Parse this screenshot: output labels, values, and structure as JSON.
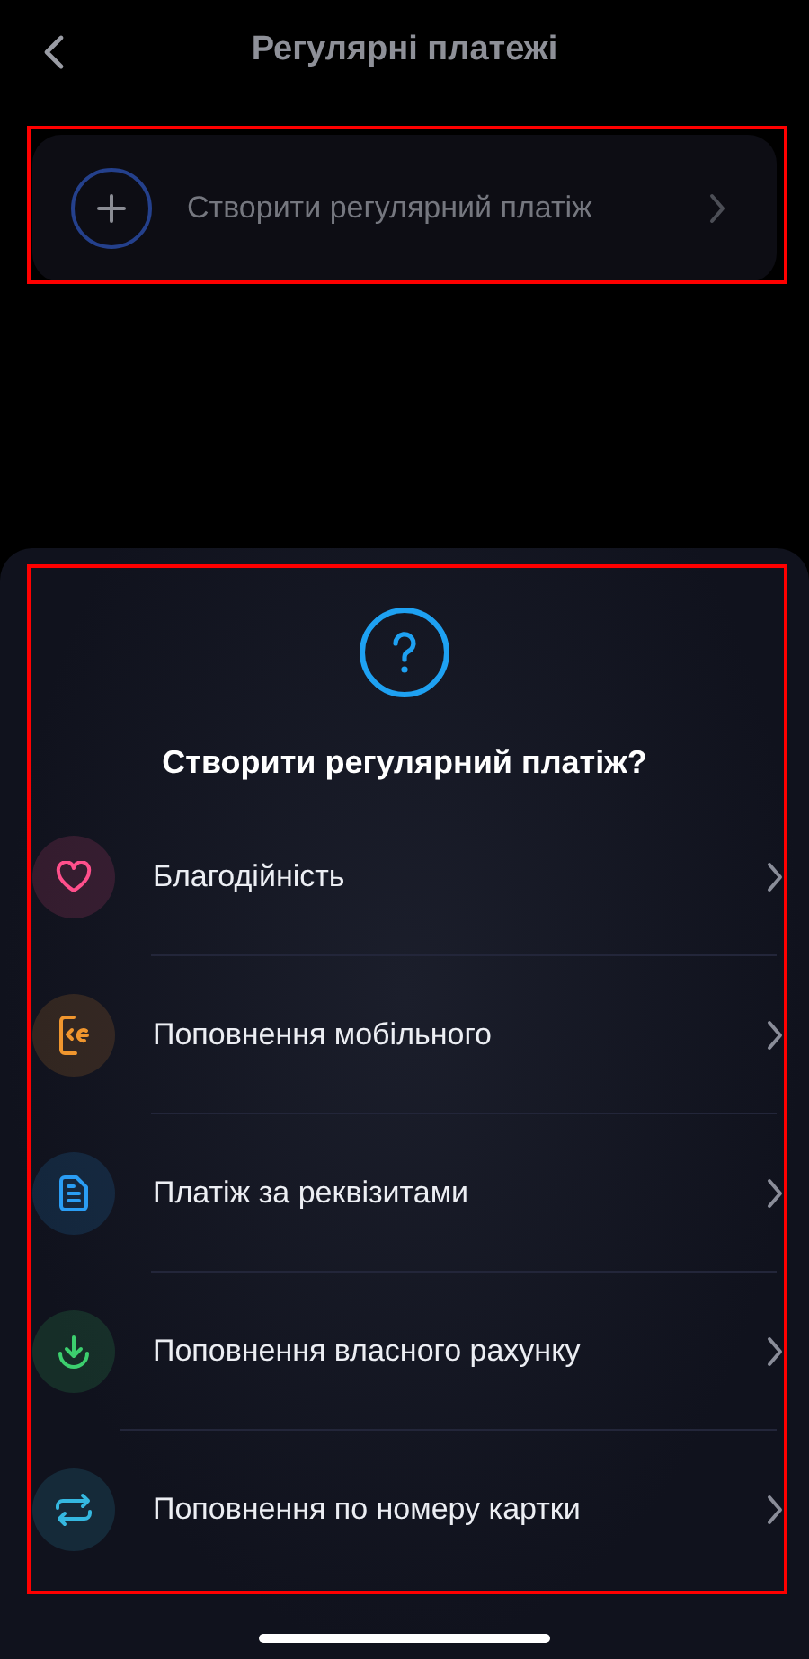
{
  "header": {
    "title": "Регулярні платежі"
  },
  "create_card": {
    "label": "Створити регулярний платіж"
  },
  "sheet": {
    "title": "Створити регулярний платіж?",
    "options": [
      {
        "kind": "heart",
        "label": "Благодійність",
        "color": "#ff4f8b"
      },
      {
        "kind": "phone",
        "label": "Поповнення мобільного",
        "color": "#f0962e"
      },
      {
        "kind": "document",
        "label": "Платіж за реквізитами",
        "color": "#2a9df4"
      },
      {
        "kind": "download",
        "label": "Поповнення власного рахунку",
        "color": "#3ccf6e"
      },
      {
        "kind": "transfer",
        "label": "Поповнення по номеру картки",
        "color": "#35b8e0"
      }
    ]
  }
}
